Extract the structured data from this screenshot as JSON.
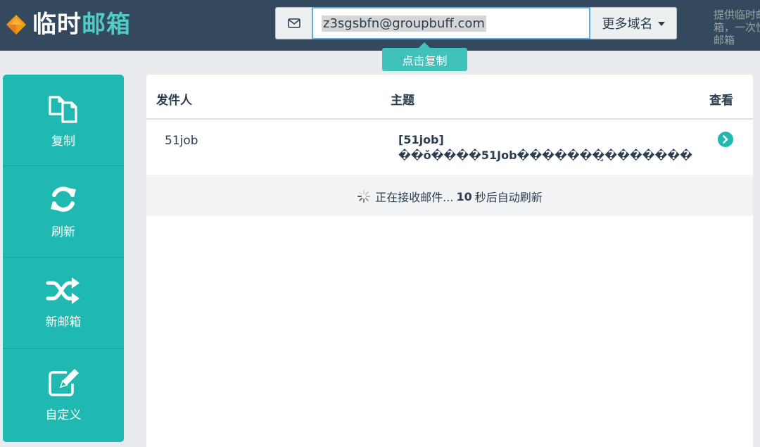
{
  "header": {
    "logo_main": "临时",
    "logo_accent": "邮箱",
    "email": "z3sgsbfn@groupbuff.com",
    "domain_button": "更多域名",
    "notice": "提供临时邮箱，一次性邮箱",
    "copy_tip": "点击复制"
  },
  "sidebar": {
    "items": [
      {
        "label": "复制",
        "icon": "copy-icon"
      },
      {
        "label": "刷新",
        "icon": "refresh-icon"
      },
      {
        "label": "新邮箱",
        "icon": "shuffle-icon"
      },
      {
        "label": "自定义",
        "icon": "edit-icon"
      }
    ]
  },
  "inbox": {
    "columns": [
      "发件人",
      "主题",
      "查看"
    ],
    "rows": [
      {
        "sender": "51job",
        "subject_line1": "[51job]",
        "subject_line2": "��ǒ����51Job�������̧�������"
      }
    ],
    "loading_prefix": "正在接收邮件...",
    "countdown": "10",
    "loading_suffix": "秒后自动刷新"
  },
  "colors": {
    "topbar": "#34495e",
    "accent": "#20b9b2",
    "logo_orange": "#f39c12"
  }
}
